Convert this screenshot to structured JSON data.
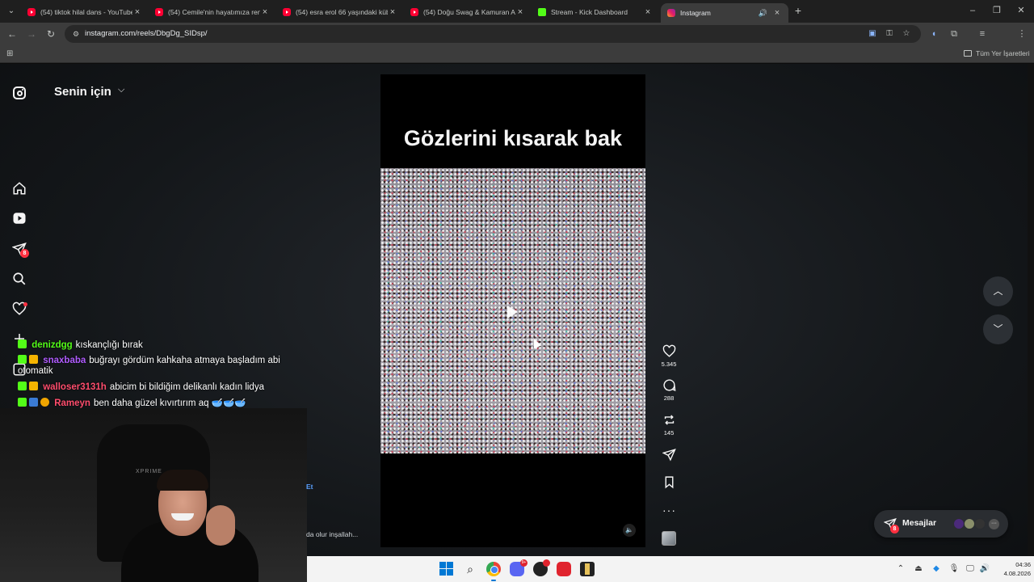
{
  "browser": {
    "tabs": [
      {
        "title": "(54) tiktok hilal dans - YouTube",
        "icon": "youtube-icon"
      },
      {
        "title": "(54) Cemile'nin hayatımıza renk",
        "icon": "youtube-icon"
      },
      {
        "title": "(54) esra erol 66 yaşındaki kübr",
        "icon": "youtube-icon"
      },
      {
        "title": "(54) Doğu Swag & Kamuran Ak",
        "icon": "youtube-icon"
      },
      {
        "title": "Stream - Kick Dashboard",
        "icon": "kick-icon"
      },
      {
        "title": "Instagram",
        "icon": "instagram-icon",
        "active": true
      }
    ],
    "url": "instagram.com/reels/DbgDg_SIDsp/",
    "bookmarks_all": "Tüm Yer İşaretleri",
    "profile_initial": "U"
  },
  "instagram": {
    "feed_title": "Senin için",
    "notification_count": "8",
    "reel": {
      "caption": "Gözlerini kısarak bak",
      "likes": "5.345",
      "comments": "288",
      "reposts": "145"
    },
    "messages_label": "Mesajlar",
    "messages_badge": "8"
  },
  "chat": [
    {
      "user": "denizdgg",
      "user_color": "#53fc18",
      "message": "kıskançlığı bırak"
    },
    {
      "user": "snaxbaba",
      "user_color": "#b05cff",
      "message": "buğrayı gördüm kahkaha atmaya başladım abi"
    },
    {
      "user": "",
      "message": "otomatik"
    },
    {
      "user": "walloser3131h",
      "user_color": "#ff4d6d",
      "message": "abicim bi bildiğim delikanlı kadın lidya"
    },
    {
      "user": "Rameyn",
      "user_color": "#ff4d6d",
      "message": "ben daha güzel kıvırtırım aq 🥣🥣🥣"
    }
  ],
  "webcam": {
    "chair_logo": "XPRIME",
    "behind_text_1": "Et",
    "behind_text_2": "da olur inşallah..."
  },
  "taskbar": {
    "time": "04:36",
    "date": "4.08.2026",
    "discord_badge": "9+"
  }
}
